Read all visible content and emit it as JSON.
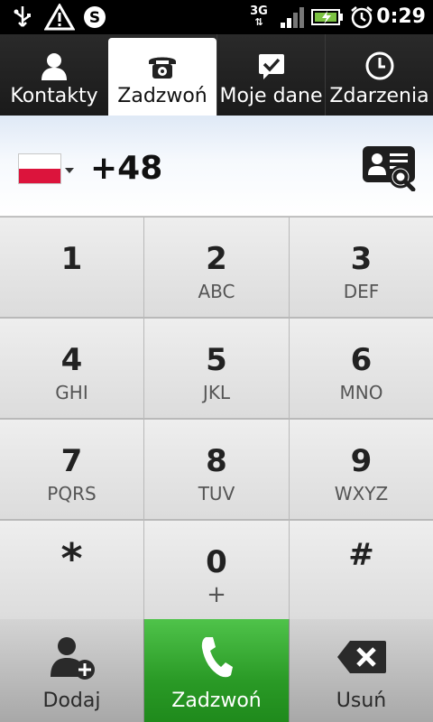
{
  "status_bar": {
    "time": "0:29",
    "network": "3G",
    "icons": [
      "usb-icon",
      "warning-icon",
      "skype-icon",
      "signal-icon",
      "battery-charging-icon",
      "alarm-icon"
    ]
  },
  "tabs": [
    {
      "label": "Kontakty",
      "icon": "person-icon",
      "active": false
    },
    {
      "label": "Zadzwoń",
      "icon": "phone-icon",
      "active": true
    },
    {
      "label": "Moje dane",
      "icon": "chat-check-icon",
      "active": false
    },
    {
      "label": "Zdarzenia",
      "icon": "clock-icon",
      "active": false
    }
  ],
  "display": {
    "country": "Poland",
    "number": "+48",
    "contact_search_icon": "contact-search-icon"
  },
  "keypad": [
    {
      "digit": "1",
      "letters": ""
    },
    {
      "digit": "2",
      "letters": "ABC"
    },
    {
      "digit": "3",
      "letters": "DEF"
    },
    {
      "digit": "4",
      "letters": "GHI"
    },
    {
      "digit": "5",
      "letters": "JKL"
    },
    {
      "digit": "6",
      "letters": "MNO"
    },
    {
      "digit": "7",
      "letters": "PQRS"
    },
    {
      "digit": "8",
      "letters": "TUV"
    },
    {
      "digit": "9",
      "letters": "WXYZ"
    },
    {
      "digit": "*",
      "letters": ""
    },
    {
      "digit": "0",
      "letters": "+"
    },
    {
      "digit": "#",
      "letters": ""
    }
  ],
  "bottom": {
    "add_label": "Dodaj",
    "call_label": "Zadzwoń",
    "delete_label": "Usuń"
  },
  "colors": {
    "call_green": "#2a9a26",
    "flag_red": "#dc143c"
  }
}
